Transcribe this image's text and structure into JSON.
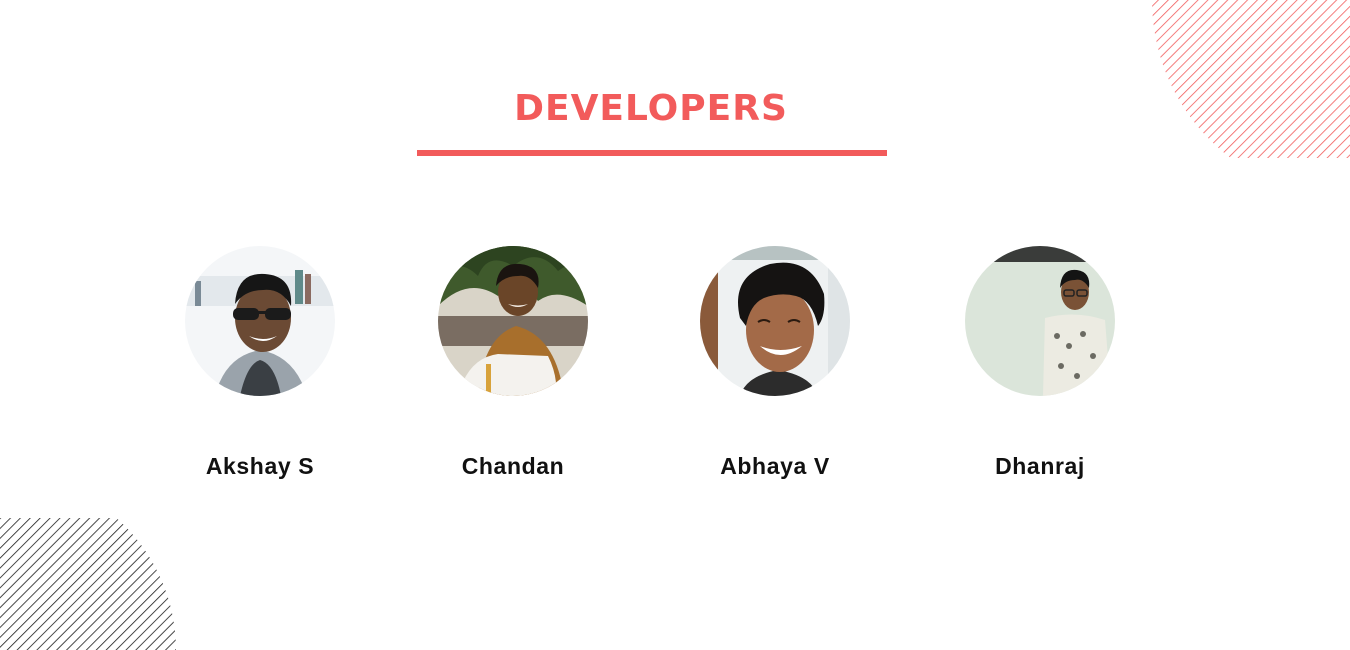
{
  "colors": {
    "accent": "#f25b5b",
    "text": "#111111",
    "stripes_dark": "#1a1a1a"
  },
  "section": {
    "title": "DEVELOPERS"
  },
  "developers": [
    {
      "name": "Akshay S",
      "photo_icon": "person-photo-icon"
    },
    {
      "name": "Chandan",
      "photo_icon": "person-photo-icon"
    },
    {
      "name": "Abhaya V",
      "photo_icon": "person-photo-icon"
    },
    {
      "name": "Dhanraj",
      "photo_icon": "person-photo-icon"
    }
  ]
}
